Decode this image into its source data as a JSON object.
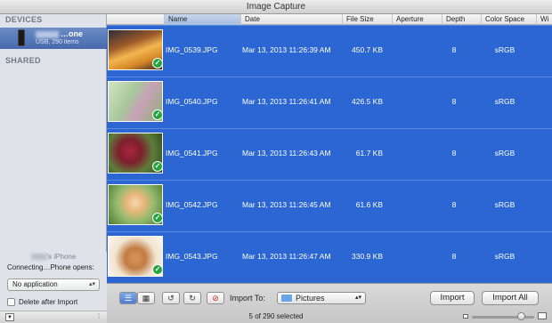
{
  "window": {
    "title": "Image Capture"
  },
  "sidebar": {
    "devices_heading": "DEVICES",
    "device": {
      "name": "…one",
      "sub": "USB, 290 items"
    },
    "shared_heading": "SHARED",
    "phone_label": "'s iPhone",
    "connecting_text": "Connecting…Phone opens:",
    "app_select": "No application",
    "delete_after_import": "Delete after Import"
  },
  "table": {
    "columns": [
      "Name",
      "Date",
      "File Size",
      "Aperture",
      "Depth",
      "Color Space",
      "Wi"
    ],
    "rows": [
      {
        "name": "IMG_0539.JPG",
        "date": "Mar 13, 2013 11:26:39 AM",
        "size": "450.7 KB",
        "depth": "8",
        "colorspace": "sRGB"
      },
      {
        "name": "IMG_0540.JPG",
        "date": "Mar 13, 2013 11:26:41 AM",
        "size": "426.5 KB",
        "depth": "8",
        "colorspace": "sRGB"
      },
      {
        "name": "IMG_0541.JPG",
        "date": "Mar 13, 2013 11:26:43 AM",
        "size": "61.7 KB",
        "depth": "8",
        "colorspace": "sRGB"
      },
      {
        "name": "IMG_0542.JPG",
        "date": "Mar 13, 2013 11:26:45 AM",
        "size": "61.6 KB",
        "depth": "8",
        "colorspace": "sRGB"
      },
      {
        "name": "IMG_0543.JPG",
        "date": "Mar 13, 2013 11:26:47 AM",
        "size": "330.9 KB",
        "depth": "8",
        "colorspace": "sRGB"
      }
    ]
  },
  "toolbar": {
    "import_to_label": "Import To:",
    "folder": "Pictures",
    "import_button": "Import",
    "import_all_button": "Import All",
    "selection_status": "5 of 290 selected",
    "thumbnail_size_level": 0.8
  },
  "colors": {
    "selection": "#2b66d3",
    "checkmark": "#27a33b"
  }
}
